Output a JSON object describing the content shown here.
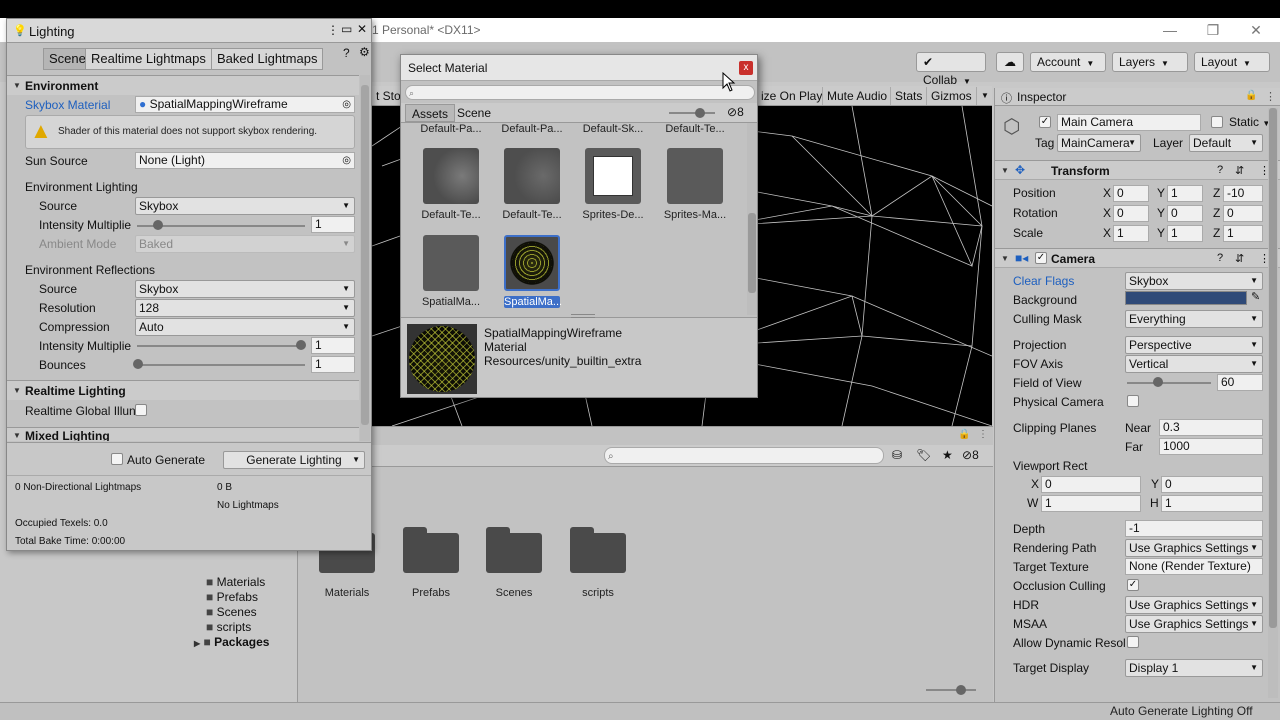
{
  "window": {
    "title": "1 Personal* <DX11>",
    "minimize": "—",
    "restore": "❐",
    "close": "✕"
  },
  "toolbar": {
    "collab": "Collab",
    "account": "Account",
    "layers": "Layers",
    "layout": "Layout"
  },
  "scene_bar": {
    "story_tab": "t Stor",
    "maximize": "ize On Play",
    "mute": "Mute Audio",
    "stats": "Stats",
    "gizmos": "Gizmos"
  },
  "lighting": {
    "title": "Lighting",
    "tabs": [
      "Scene",
      "Realtime Lightmaps",
      "Baked Lightmaps"
    ],
    "environment_header": "Environment",
    "skybox_material_label": "Skybox Material",
    "skybox_material_value": "SpatialMappingWireframe",
    "warning": "Shader of this material does not support skybox rendering.",
    "sun_source_label": "Sun Source",
    "sun_source_value": "None (Light)",
    "env_lighting_label": "Environment Lighting",
    "source_label": "Source",
    "source_value": "Skybox",
    "intensity_label": "Intensity Multiplie",
    "intensity_value": "1",
    "ambient_mode_label": "Ambient Mode",
    "ambient_mode_value": "Baked",
    "env_reflections_label": "Environment Reflections",
    "refl_source_label": "Source",
    "refl_source_value": "Skybox",
    "resolution_label": "Resolution",
    "resolution_value": "128",
    "compression_label": "Compression",
    "compression_value": "Auto",
    "refl_intensity_label": "Intensity Multiplie",
    "refl_intensity_value": "1",
    "bounces_label": "Bounces",
    "bounces_value": "1",
    "realtime_header": "Realtime Lighting",
    "realtime_gi_label": "Realtime Global Illun",
    "mixed_header": "Mixed Lighting",
    "auto_generate_label": "Auto Generate",
    "generate_button": "Generate Lighting",
    "stats_lightmaps": "0 Non-Directional Lightmaps",
    "stats_size": "0 B",
    "stats_no_lightmaps": "No Lightmaps",
    "stats_texels": "Occupied Texels: 0.0",
    "stats_bake_time": "Total Bake Time: 0:00:00"
  },
  "select_material": {
    "title": "Select Material",
    "close": "x",
    "tabs": [
      "Assets",
      "Scene"
    ],
    "hidden_count": "8",
    "top_row_labels": [
      "Default-Pa...",
      "Default-Pa...",
      "Default-Sk...",
      "Default-Te..."
    ],
    "items": [
      {
        "label": "Default-Te...",
        "kind": "sphere-gray"
      },
      {
        "label": "Default-Te...",
        "kind": "sphere-gray"
      },
      {
        "label": "Sprites-De...",
        "kind": "white-square"
      },
      {
        "label": "Sprites-Ma...",
        "kind": "plain-gray"
      },
      {
        "label": "SpatialMa...",
        "kind": "plain-gray"
      },
      {
        "label": "SpatialMa...",
        "kind": "wireframe-sphere",
        "selected": true
      }
    ],
    "preview_name": "SpatialMappingWireframe",
    "preview_type": "Material",
    "preview_path": "Resources/unity_builtin_extra"
  },
  "project": {
    "hidden_count": "8",
    "tree": [
      "Materials",
      "Prefabs",
      "Scenes",
      "scripts"
    ],
    "packages": "Packages",
    "folders": [
      "Materials",
      "Prefabs",
      "Scenes",
      "scripts"
    ]
  },
  "inspector": {
    "tab": "Inspector",
    "object_name": "Main Camera",
    "static_label": "Static",
    "tag_label": "Tag",
    "tag_value": "MainCamera",
    "layer_label": "Layer",
    "layer_value": "Default",
    "transform": {
      "header": "Transform",
      "position_label": "Position",
      "position": [
        "0",
        "1",
        "-10"
      ],
      "rotation_label": "Rotation",
      "rotation": [
        "0",
        "0",
        "0"
      ],
      "scale_label": "Scale",
      "scale": [
        "1",
        "1",
        "1"
      ]
    },
    "camera": {
      "header": "Camera",
      "clear_flags_label": "Clear Flags",
      "clear_flags_value": "Skybox",
      "background_label": "Background",
      "background_color": "#2f4a78",
      "culling_mask_label": "Culling Mask",
      "culling_mask_value": "Everything",
      "projection_label": "Projection",
      "projection_value": "Perspective",
      "fov_axis_label": "FOV Axis",
      "fov_axis_value": "Vertical",
      "fov_label": "Field of View",
      "fov_value": "60",
      "physical_label": "Physical Camera",
      "clipping_label": "Clipping Planes",
      "near_label": "Near",
      "near_value": "0.3",
      "far_label": "Far",
      "far_value": "1000",
      "viewport_label": "Viewport Rect",
      "vp_x": "0",
      "vp_y": "0",
      "vp_w": "1",
      "vp_h": "1",
      "depth_label": "Depth",
      "depth_value": "-1",
      "rendering_path_label": "Rendering Path",
      "rendering_path_value": "Use Graphics Settings",
      "target_texture_label": "Target Texture",
      "target_texture_value": "None (Render Texture)",
      "occlusion_label": "Occlusion Culling",
      "hdr_label": "HDR",
      "hdr_value": "Use Graphics Settings",
      "msaa_label": "MSAA",
      "msaa_value": "Use Graphics Settings",
      "dynamic_res_label": "Allow Dynamic Resol",
      "target_display_label": "Target Display",
      "target_display_value": "Display 1"
    }
  },
  "status": {
    "text": "Auto Generate Lighting Off"
  },
  "axes": {
    "x": "X",
    "y": "Y",
    "z": "Z",
    "w": "W",
    "h": "H"
  },
  "colors": {
    "accent_blue": "#2f6fd1",
    "selection": "#3d6fc8",
    "wireframe": "#c8d03a"
  }
}
